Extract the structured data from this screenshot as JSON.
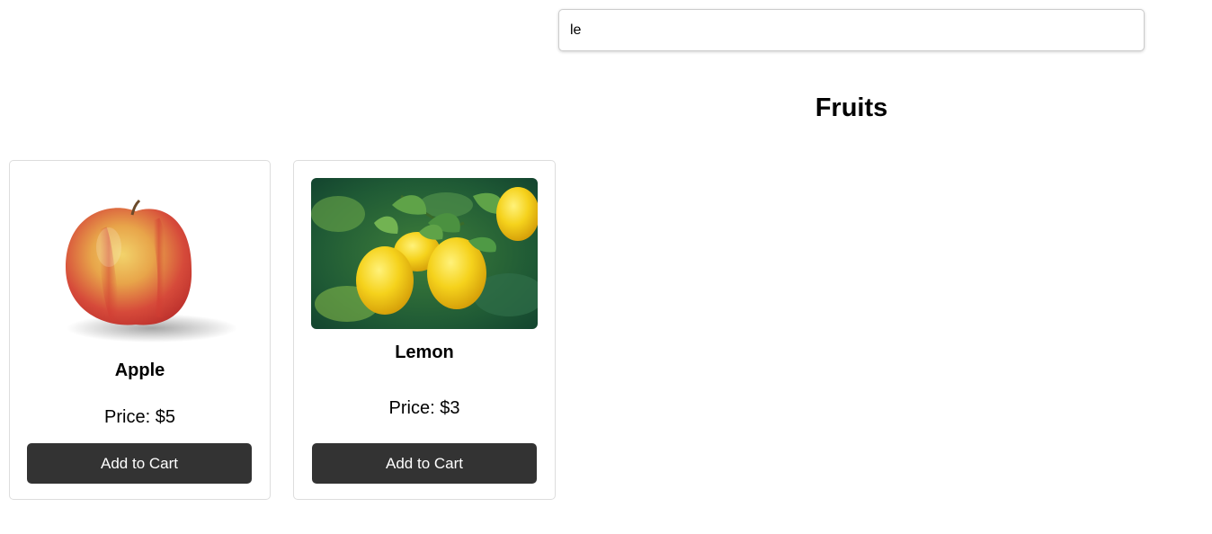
{
  "search": {
    "value": "le"
  },
  "section": {
    "title": "Fruits"
  },
  "products": [
    {
      "name": "Apple",
      "price": "Price: $5",
      "button_label": "Add to Cart",
      "image_icon": "apple-image"
    },
    {
      "name": "Lemon",
      "price": "Price: $3",
      "button_label": "Add to Cart",
      "image_icon": "lemon-image"
    }
  ],
  "colors": {
    "button_bg": "#333333",
    "button_text": "#ffffff",
    "card_border": "#dddddd"
  }
}
